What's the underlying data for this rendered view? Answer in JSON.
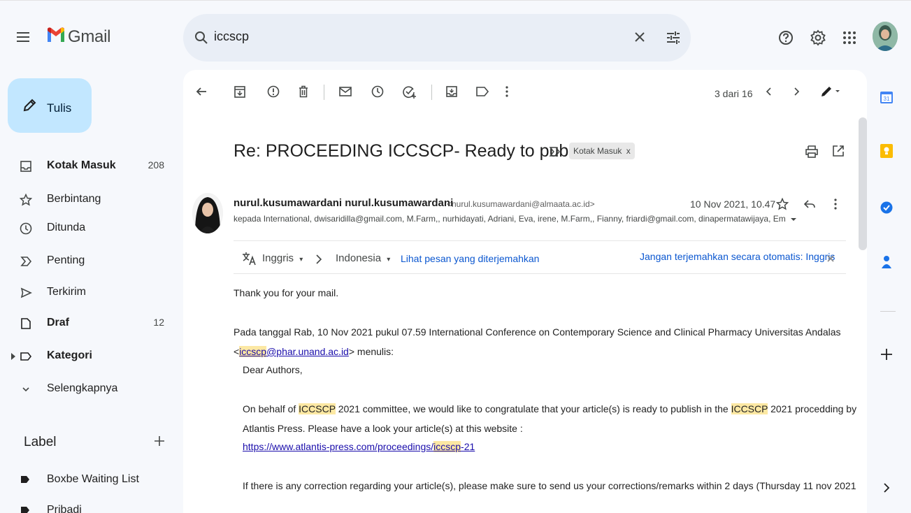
{
  "app": {
    "name": "Gmail"
  },
  "search": {
    "query": "iccscp"
  },
  "nav": {
    "compose_label": "Tulis",
    "items": [
      {
        "label": "Kotak Masuk",
        "count": "208",
        "bold": true
      },
      {
        "label": "Berbintang",
        "count": "",
        "bold": false
      },
      {
        "label": "Ditunda",
        "count": "",
        "bold": false
      },
      {
        "label": "Penting",
        "count": "",
        "bold": false
      },
      {
        "label": "Terkirim",
        "count": "",
        "bold": false
      },
      {
        "label": "Draf",
        "count": "12",
        "bold": true
      },
      {
        "label": "Kategori",
        "count": "",
        "bold": true
      },
      {
        "label": "Selengkapnya",
        "count": "",
        "bold": false
      }
    ],
    "labels_heading": "Label",
    "labels": [
      {
        "label": "Boxbe Waiting List"
      },
      {
        "label": "Pribadi"
      }
    ]
  },
  "toolbar": {
    "pager": "3 dari 16"
  },
  "message": {
    "subject": "Re: PROCEEDING ICCSCP- Ready to publish",
    "chip": "Kotak Masuk",
    "chip_close": "x",
    "sender_name": "nurul.kusumawardani nurul.kusumawardani",
    "sender_email": "<nurul.kusumawardani@almaata.ac.id>",
    "date": "10 Nov 2021, 10.47",
    "recipients": "kepada International, dwisaridilla@gmail.com, M.Farm,, nurhidayati, Adriani, Eva, irene, M.Farm,, Fianny, friardi@gmail.com, dinapermatawijaya, Em"
  },
  "translate": {
    "from": "Inggris",
    "to": "Indonesia",
    "view_link": "Lihat pesan yang diterjemahkan",
    "never_link": "Jangan terjemahkan secara otomatis: Inggris",
    "close": "x"
  },
  "body": {
    "line1": "Thank you for your mail.",
    "line2": "Pada tanggal Rab, 10 Nov 2021 pukul 07.59 International Conference on Contemporary Science and Clinical Pharmacy Universitas Andalas",
    "line3_pre": "<",
    "line3_hl": "iccscp",
    "line3_link": "@phar.unand.ac.id",
    "line3_post": "> menulis:",
    "line4": "Dear Authors,",
    "p1_a": "On behalf of ",
    "p1_hl1": "ICCSCP",
    "p1_b": " 2021 committee, we would like to congratulate that your article(s) is ready to publish in the ",
    "p1_hl2": "ICCSCP",
    "p1_c": " 2021 procedding by",
    "p1_line2": "Atlantis Press. Please have a look your article(s) at this website :",
    "url_a": "https://www.atlantis-press.com/proceedings/",
    "url_hl": "iccscp",
    "url_b": "-21",
    "p2": "If there is any correction regarding your article(s), please make sure to send us your corrections/remarks within 2 days (Thursday 11 nov 2021"
  },
  "colors": {
    "compose_bg": "#c2e7ff",
    "search_bg": "#e9eef6",
    "highlight": "#fce8a3",
    "link": "#0b57d0"
  }
}
